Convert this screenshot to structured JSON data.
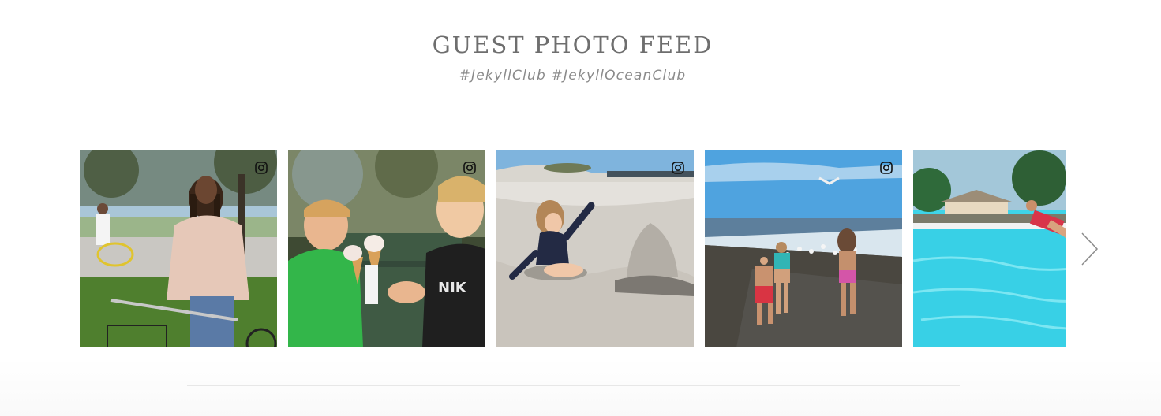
{
  "feed": {
    "title": "GUEST PHOTO FEED",
    "hashtags": "#JekyllClub #JekyllOceanClub"
  },
  "photos": [
    {
      "icon": "instagram-icon"
    },
    {
      "icon": "instagram-icon"
    },
    {
      "icon": "instagram-icon"
    },
    {
      "icon": "instagram-icon"
    },
    {
      "icon": "instagram-icon"
    }
  ],
  "carousel": {
    "next_icon": "chevron-right-icon"
  },
  "colors": {
    "title": "#6e6e6e",
    "subtitle": "#8a8a8a",
    "divider": "#e7e7e7"
  }
}
